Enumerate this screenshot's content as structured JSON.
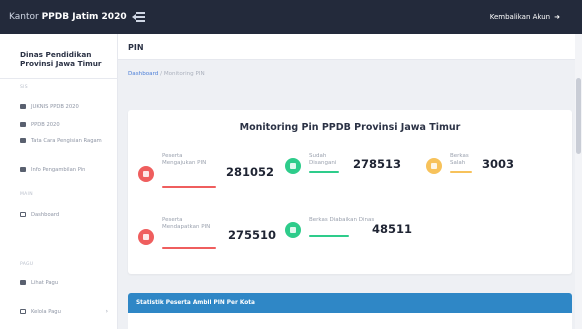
{
  "header": {
    "brand_prefix": "Kantor ",
    "brand_strong": "PPDB Jatim 2020",
    "back_label": "Kembalikan Akun"
  },
  "sidebar": {
    "title": "Dinas Pendidikan Provinsi Jawa Timur",
    "section_1": "SIS",
    "items_1": [
      {
        "label": "JUKNIS PPDB 2020",
        "icon": "book-icon"
      },
      {
        "label": "PPDB 2020",
        "icon": "book-icon"
      },
      {
        "label": "Tata Cara Pengisian Ragam",
        "icon": "book-icon"
      },
      {
        "label": "Info Pengambilan Pin",
        "icon": "book-icon"
      }
    ],
    "section_2": "MAIN",
    "items_2": [
      {
        "label": "Dashboard",
        "icon": "dashboard-icon"
      }
    ],
    "section_3": "PAGU",
    "items_3": [
      {
        "label": "Lihat Pagu",
        "icon": "table-icon"
      },
      {
        "label": "Kelola Pagu",
        "icon": "table-icon",
        "has_children": true
      }
    ]
  },
  "page": {
    "title": "PIN",
    "breadcrumb_link": "Dashboard",
    "breadcrumb_sep": " / ",
    "breadcrumb_current": "Monitoring PIN"
  },
  "monitoring": {
    "title": "Monitoring Pin PPDB Provinsi Jawa Timur",
    "stats": [
      {
        "label": "Peserta Mengajukan PIN",
        "value": "281052",
        "color": "#ef5e5e"
      },
      {
        "label": "Sudah Disangani",
        "value": "278513",
        "color": "#2ecc8b"
      },
      {
        "label": "Berkas Salah",
        "value": "3003",
        "color": "#f7c25b"
      },
      {
        "label": "Peserta Mendapatkan PIN",
        "value": "275510",
        "color": "#ef5e5e"
      },
      {
        "label": "Berkas Diabaikan Dinas",
        "value": "48511",
        "color": "#2ecc8b"
      }
    ]
  },
  "city_panel": {
    "title": "Statistik Peserta Ambil PIN Per Kota",
    "color": "#2f87c6"
  },
  "colors": {
    "topbar": "#232a3b",
    "accent_link": "#4c7fd8",
    "red": "#ef5e5e",
    "green": "#2ecc8b",
    "yellow": "#f7c25b"
  }
}
